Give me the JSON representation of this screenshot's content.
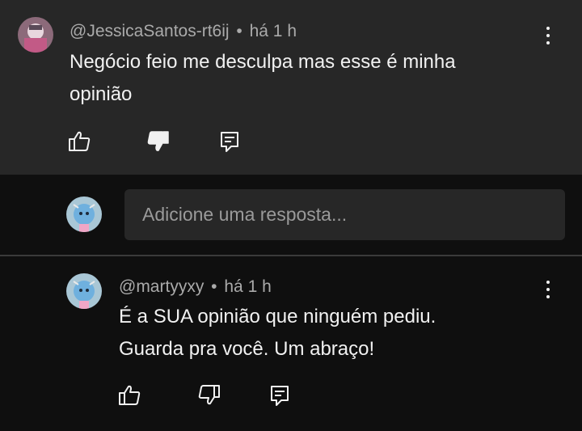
{
  "comment": {
    "handle": "@JessicaSantos-rt6ij",
    "separator": "•",
    "time": "há 1 h",
    "text_line1": "Negócio feio me desculpa mas esse é minha",
    "text_line2": "opinião",
    "icons": [
      "like-icon",
      "dislike-icon",
      "reply-icon",
      "more-options-icon"
    ]
  },
  "reply_input": {
    "placeholder": "Adicione uma resposta..."
  },
  "reply": {
    "handle": "@martyyxy",
    "separator": "•",
    "time": "há 1 h",
    "text_line1": "É a SUA opinião que ninguém pediu.",
    "text_line2": "Guarda pra você. Um abraço!",
    "icons": [
      "like-icon",
      "dislike-icon",
      "reply-icon",
      "more-options-icon"
    ]
  },
  "colors": {
    "background": "#0f0f0f",
    "highlighted_comment": "#272727",
    "text": "#f1f1f1",
    "meta_text": "#aaaaaa"
  }
}
